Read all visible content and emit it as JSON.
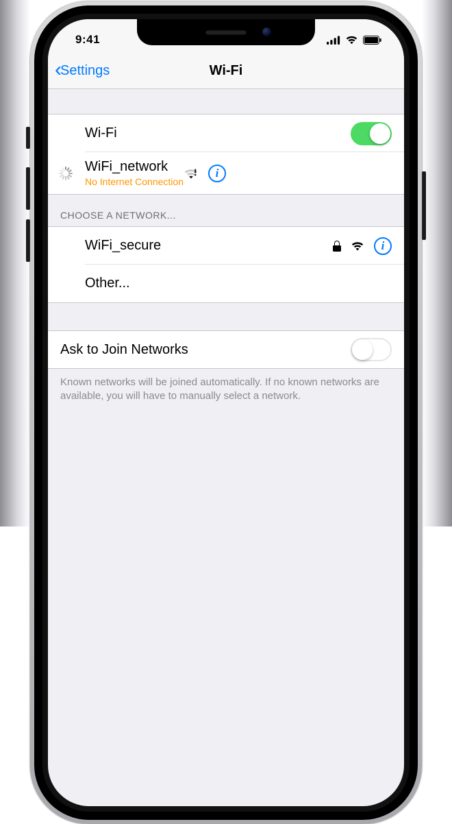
{
  "status": {
    "time": "9:41"
  },
  "nav": {
    "back": "Settings",
    "title": "Wi-Fi"
  },
  "wifi": {
    "toggle_label": "Wi-Fi",
    "toggle_on": true,
    "connected": {
      "name": "WiFi_network",
      "status": "No Internet Connection"
    }
  },
  "choose": {
    "header": "CHOOSE A NETWORK...",
    "items": [
      {
        "name": "WiFi_secure",
        "locked": true
      },
      {
        "name": "Other..."
      }
    ]
  },
  "ask": {
    "label": "Ask to Join Networks",
    "on": false,
    "footer": "Known networks will be joined automatically. If no known networks are available, you will have to manually select a network."
  }
}
